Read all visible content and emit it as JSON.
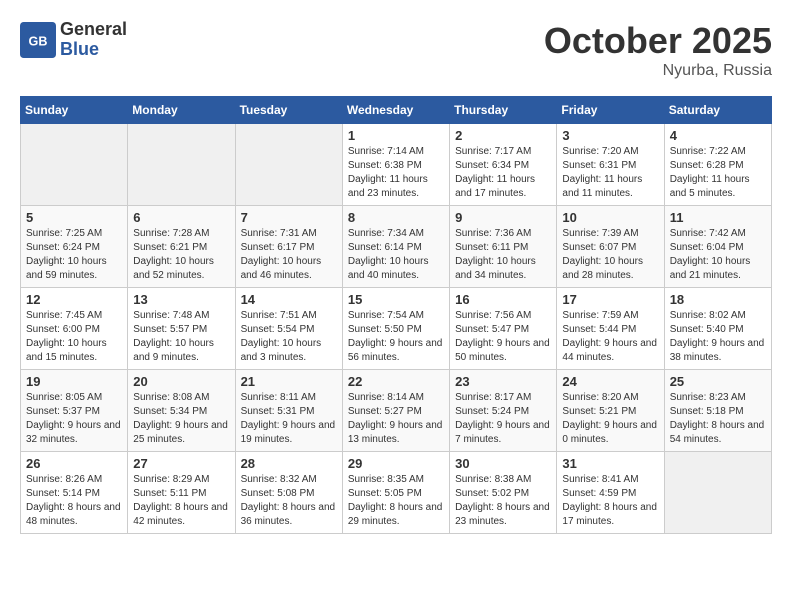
{
  "header": {
    "logo_line1": "General",
    "logo_line2": "Blue",
    "month": "October 2025",
    "location": "Nyurba, Russia"
  },
  "weekdays": [
    "Sunday",
    "Monday",
    "Tuesday",
    "Wednesday",
    "Thursday",
    "Friday",
    "Saturday"
  ],
  "weeks": [
    [
      {
        "day": "",
        "sunrise": "",
        "sunset": "",
        "daylight": ""
      },
      {
        "day": "",
        "sunrise": "",
        "sunset": "",
        "daylight": ""
      },
      {
        "day": "",
        "sunrise": "",
        "sunset": "",
        "daylight": ""
      },
      {
        "day": "1",
        "sunrise": "Sunrise: 7:14 AM",
        "sunset": "Sunset: 6:38 PM",
        "daylight": "Daylight: 11 hours and 23 minutes."
      },
      {
        "day": "2",
        "sunrise": "Sunrise: 7:17 AM",
        "sunset": "Sunset: 6:34 PM",
        "daylight": "Daylight: 11 hours and 17 minutes."
      },
      {
        "day": "3",
        "sunrise": "Sunrise: 7:20 AM",
        "sunset": "Sunset: 6:31 PM",
        "daylight": "Daylight: 11 hours and 11 minutes."
      },
      {
        "day": "4",
        "sunrise": "Sunrise: 7:22 AM",
        "sunset": "Sunset: 6:28 PM",
        "daylight": "Daylight: 11 hours and 5 minutes."
      }
    ],
    [
      {
        "day": "5",
        "sunrise": "Sunrise: 7:25 AM",
        "sunset": "Sunset: 6:24 PM",
        "daylight": "Daylight: 10 hours and 59 minutes."
      },
      {
        "day": "6",
        "sunrise": "Sunrise: 7:28 AM",
        "sunset": "Sunset: 6:21 PM",
        "daylight": "Daylight: 10 hours and 52 minutes."
      },
      {
        "day": "7",
        "sunrise": "Sunrise: 7:31 AM",
        "sunset": "Sunset: 6:17 PM",
        "daylight": "Daylight: 10 hours and 46 minutes."
      },
      {
        "day": "8",
        "sunrise": "Sunrise: 7:34 AM",
        "sunset": "Sunset: 6:14 PM",
        "daylight": "Daylight: 10 hours and 40 minutes."
      },
      {
        "day": "9",
        "sunrise": "Sunrise: 7:36 AM",
        "sunset": "Sunset: 6:11 PM",
        "daylight": "Daylight: 10 hours and 34 minutes."
      },
      {
        "day": "10",
        "sunrise": "Sunrise: 7:39 AM",
        "sunset": "Sunset: 6:07 PM",
        "daylight": "Daylight: 10 hours and 28 minutes."
      },
      {
        "day": "11",
        "sunrise": "Sunrise: 7:42 AM",
        "sunset": "Sunset: 6:04 PM",
        "daylight": "Daylight: 10 hours and 21 minutes."
      }
    ],
    [
      {
        "day": "12",
        "sunrise": "Sunrise: 7:45 AM",
        "sunset": "Sunset: 6:00 PM",
        "daylight": "Daylight: 10 hours and 15 minutes."
      },
      {
        "day": "13",
        "sunrise": "Sunrise: 7:48 AM",
        "sunset": "Sunset: 5:57 PM",
        "daylight": "Daylight: 10 hours and 9 minutes."
      },
      {
        "day": "14",
        "sunrise": "Sunrise: 7:51 AM",
        "sunset": "Sunset: 5:54 PM",
        "daylight": "Daylight: 10 hours and 3 minutes."
      },
      {
        "day": "15",
        "sunrise": "Sunrise: 7:54 AM",
        "sunset": "Sunset: 5:50 PM",
        "daylight": "Daylight: 9 hours and 56 minutes."
      },
      {
        "day": "16",
        "sunrise": "Sunrise: 7:56 AM",
        "sunset": "Sunset: 5:47 PM",
        "daylight": "Daylight: 9 hours and 50 minutes."
      },
      {
        "day": "17",
        "sunrise": "Sunrise: 7:59 AM",
        "sunset": "Sunset: 5:44 PM",
        "daylight": "Daylight: 9 hours and 44 minutes."
      },
      {
        "day": "18",
        "sunrise": "Sunrise: 8:02 AM",
        "sunset": "Sunset: 5:40 PM",
        "daylight": "Daylight: 9 hours and 38 minutes."
      }
    ],
    [
      {
        "day": "19",
        "sunrise": "Sunrise: 8:05 AM",
        "sunset": "Sunset: 5:37 PM",
        "daylight": "Daylight: 9 hours and 32 minutes."
      },
      {
        "day": "20",
        "sunrise": "Sunrise: 8:08 AM",
        "sunset": "Sunset: 5:34 PM",
        "daylight": "Daylight: 9 hours and 25 minutes."
      },
      {
        "day": "21",
        "sunrise": "Sunrise: 8:11 AM",
        "sunset": "Sunset: 5:31 PM",
        "daylight": "Daylight: 9 hours and 19 minutes."
      },
      {
        "day": "22",
        "sunrise": "Sunrise: 8:14 AM",
        "sunset": "Sunset: 5:27 PM",
        "daylight": "Daylight: 9 hours and 13 minutes."
      },
      {
        "day": "23",
        "sunrise": "Sunrise: 8:17 AM",
        "sunset": "Sunset: 5:24 PM",
        "daylight": "Daylight: 9 hours and 7 minutes."
      },
      {
        "day": "24",
        "sunrise": "Sunrise: 8:20 AM",
        "sunset": "Sunset: 5:21 PM",
        "daylight": "Daylight: 9 hours and 0 minutes."
      },
      {
        "day": "25",
        "sunrise": "Sunrise: 8:23 AM",
        "sunset": "Sunset: 5:18 PM",
        "daylight": "Daylight: 8 hours and 54 minutes."
      }
    ],
    [
      {
        "day": "26",
        "sunrise": "Sunrise: 8:26 AM",
        "sunset": "Sunset: 5:14 PM",
        "daylight": "Daylight: 8 hours and 48 minutes."
      },
      {
        "day": "27",
        "sunrise": "Sunrise: 8:29 AM",
        "sunset": "Sunset: 5:11 PM",
        "daylight": "Daylight: 8 hours and 42 minutes."
      },
      {
        "day": "28",
        "sunrise": "Sunrise: 8:32 AM",
        "sunset": "Sunset: 5:08 PM",
        "daylight": "Daylight: 8 hours and 36 minutes."
      },
      {
        "day": "29",
        "sunrise": "Sunrise: 8:35 AM",
        "sunset": "Sunset: 5:05 PM",
        "daylight": "Daylight: 8 hours and 29 minutes."
      },
      {
        "day": "30",
        "sunrise": "Sunrise: 8:38 AM",
        "sunset": "Sunset: 5:02 PM",
        "daylight": "Daylight: 8 hours and 23 minutes."
      },
      {
        "day": "31",
        "sunrise": "Sunrise: 8:41 AM",
        "sunset": "Sunset: 4:59 PM",
        "daylight": "Daylight: 8 hours and 17 minutes."
      },
      {
        "day": "",
        "sunrise": "",
        "sunset": "",
        "daylight": ""
      }
    ]
  ]
}
